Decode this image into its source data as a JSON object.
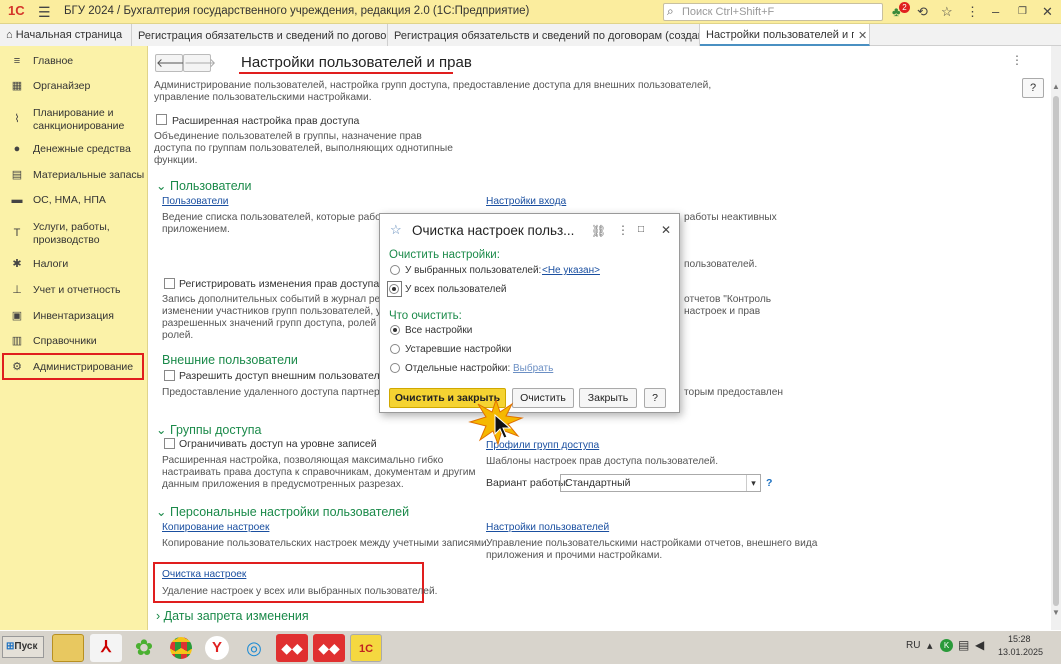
{
  "titlebar": {
    "logo": "1С",
    "title": "БГУ 2024 / Бухгалтерия государственного учреждения, редакция 2.0  (1С:Предприятие)",
    "search_placeholder": "Поиск Ctrl+Shift+F",
    "notif_count": "2"
  },
  "tabs": [
    {
      "label": "Начальная страница"
    },
    {
      "label": "Регистрация обязательств и сведений по договорам"
    },
    {
      "label": "Регистрация обязательств и сведений по договорам (создание) *"
    },
    {
      "label": "Настройки пользователей и прав"
    }
  ],
  "sidebar": {
    "items": [
      {
        "label": "Главное",
        "icon": "menu-icon"
      },
      {
        "label": "Органайзер",
        "icon": "calendar-icon"
      },
      {
        "label": "Планирование и",
        "label2": "санкционирование",
        "icon": "chart-icon"
      },
      {
        "label": "Денежные средства",
        "icon": "coin-icon"
      },
      {
        "label": "Материальные запасы",
        "icon": "grid-icon"
      },
      {
        "label": "ОС, НМА, НПА",
        "icon": "truck-icon"
      },
      {
        "label": "Услуги, работы,",
        "label2": "производство",
        "icon": "tools-icon"
      },
      {
        "label": "Налоги",
        "icon": "gear-bug-icon"
      },
      {
        "label": "Учет и отчетность",
        "icon": "report-icon"
      },
      {
        "label": "Инвентаризация",
        "icon": "clipboard-icon"
      },
      {
        "label": "Справочники",
        "icon": "book-icon"
      },
      {
        "label": "Администрирование",
        "icon": "gear-icon"
      }
    ]
  },
  "page": {
    "title": "Настройки пользователей и прав",
    "description": "Администрирование пользователей, настройка групп доступа, предоставление доступа для внешних пользователей,",
    "description2": "управление пользовательскими настройками.",
    "ext_access": {
      "label": "Расширенная настройка прав доступа",
      "note1": "Объединение пользователей в группы, назначение прав",
      "note2": "доступа по группам пользователей, выполняющих однотипные",
      "note3": "функции."
    },
    "users_section": "Пользователи",
    "users_link": "Пользователи",
    "users_note1": "Ведение списка пользователей, которые работают",
    "users_note2": "приложением.",
    "login_link": "Настройки входа",
    "login_note1": "работы неактивных",
    "login_note2": "пользователей.",
    "log_changes": {
      "label": "Регистрировать изменения прав доступа",
      "note1": "Запись дополнительных событий в журнал регис",
      "note2": "изменении участников групп пользователей, уча",
      "note3": "разрешенных значений групп доступа, ролей про",
      "note4": "ролей."
    },
    "right_note1": "отчетов \"Контроль",
    "right_note2": "настроек и прав",
    "external_section": "Внешние пользователи",
    "external_cb": "Разрешить доступ внешним пользователям",
    "external_note": "Предоставление удаленного доступа партнерам",
    "external_right": "торым предоставлен",
    "access_section": "Группы доступа",
    "restrict_cb": "Ограничивать доступ на уровне записей",
    "restrict_note1": "Расширенная настройка, позволяющая максимально гибко",
    "restrict_note2": "настраивать права доступа к справочникам, документам и другим",
    "restrict_note3": "данным приложения в предусмотренных разрезах.",
    "profiles_link": "Профили групп доступа",
    "profiles_note": "Шаблоны настроек прав доступа пользователей.",
    "variant_label": "Вариант работы:",
    "variant_value": "Стандартный",
    "personal_section": "Персональные настройки пользователей",
    "copy_link": "Копирование настроек",
    "copy_note": "Копирование пользовательских настроек между учетными записями.",
    "usersettings_link": "Настройки пользователей",
    "usersettings_note1": "Управление пользовательскими настройками отчетов, внешнего вида",
    "usersettings_note2": "приложения и прочими настройками.",
    "clear_link": "Очистка настроек",
    "clear_note": "Удаление настроек у всех или выбранных пользователей.",
    "dates_section": "Даты запрета изменения",
    "help": "?"
  },
  "dialog": {
    "title": "Очистка настроек польз...",
    "clear_heading": "Очистить настройки:",
    "opt_selected": "У выбранных пользователей:",
    "not_specified": "<Не указан>",
    "opt_all": "У всех пользователей",
    "what_heading": "Что очистить:",
    "opt_all_settings": "Все настройки",
    "opt_outdated": "Устаревшие настройки",
    "opt_individual": "Отдельные настройки:",
    "select_link": "Выбрать",
    "btn_clear_close": "Очистить и закрыть",
    "btn_clear": "Очистить",
    "btn_close": "Закрыть",
    "btn_help": "?"
  },
  "taskbar": {
    "start": "Пуск",
    "lang": "RU",
    "time": "15:28",
    "date": "13.01.2025"
  }
}
